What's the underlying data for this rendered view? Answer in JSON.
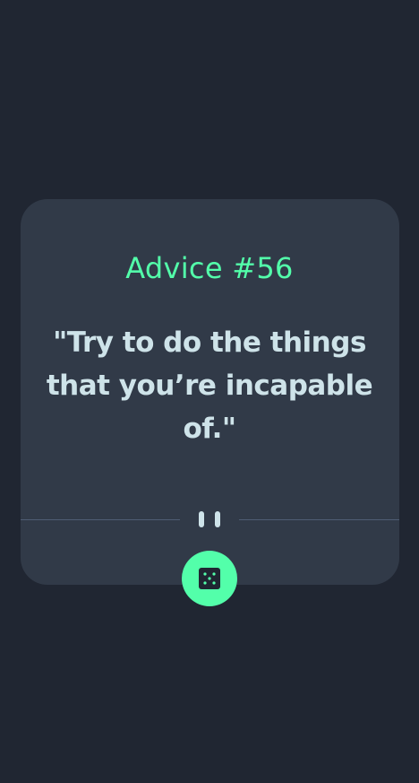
{
  "card": {
    "title": "Advice #56",
    "quote": "\"Try to do the things that you’re incapable of.\""
  },
  "divider": {
    "icon": "pause-icon"
  },
  "button": {
    "icon": "dice-icon"
  },
  "colors": {
    "background": "#202632",
    "card": "#313a48",
    "accent": "#53ffaa",
    "text": "#cee3e9",
    "divider": "#4f5d74"
  }
}
